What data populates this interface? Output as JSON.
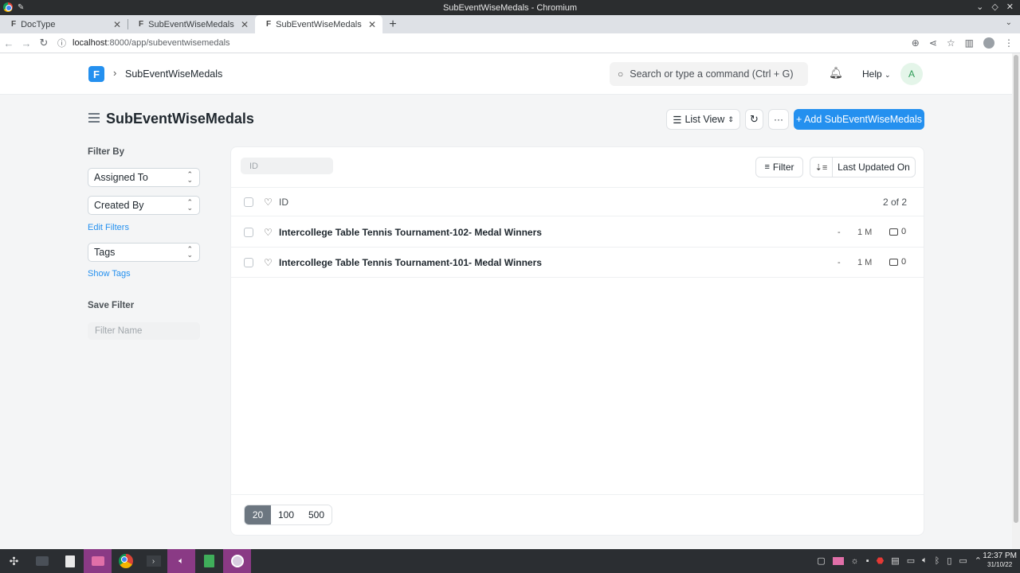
{
  "window": {
    "title": "SubEventWiseMedals - Chromium"
  },
  "browser": {
    "tabs": [
      {
        "label": "DocType",
        "active": false
      },
      {
        "label": "SubEventWiseMedals",
        "active": false
      },
      {
        "label": "SubEventWiseMedals",
        "active": true
      }
    ],
    "url_host": "localhost",
    "url_path": ":8000/app/subeventwisemedals"
  },
  "navbar": {
    "logo_letter": "F",
    "breadcrumb": "SubEventWiseMedals",
    "search_placeholder": "Search or type a command (Ctrl + G)",
    "help_label": "Help",
    "avatar_letter": "A"
  },
  "page": {
    "title": "SubEventWiseMedals",
    "list_view_label": "List View",
    "add_button_label": "+ Add SubEventWiseMedals"
  },
  "sidebar": {
    "filter_by_heading": "Filter By",
    "assigned_to": "Assigned To",
    "created_by": "Created By",
    "edit_filters": "Edit Filters",
    "tags": "Tags",
    "show_tags": "Show Tags",
    "save_filter_heading": "Save Filter",
    "filter_name_placeholder": "Filter Name"
  },
  "list": {
    "id_filter_placeholder": "ID",
    "filter_label": "Filter",
    "sort_label": "Last Updated On",
    "header_id": "ID",
    "count": "2 of 2",
    "rows": [
      {
        "title": "Intercollege Table Tennis Tournament-102- Medal Winners",
        "status": "-",
        "modified": "1 M",
        "comments": "0"
      },
      {
        "title": "Intercollege Table Tennis Tournament-101- Medal Winners",
        "status": "-",
        "modified": "1 M",
        "comments": "0"
      }
    ],
    "page_sizes": [
      "20",
      "100",
      "500"
    ],
    "active_page_size": "20"
  },
  "taskbar": {
    "time": "12:37 PM",
    "date": "31/10/22"
  },
  "colors": {
    "primary": "#2490ef",
    "page_background": "#f4f5f6",
    "pager_active": "#6c7680"
  }
}
